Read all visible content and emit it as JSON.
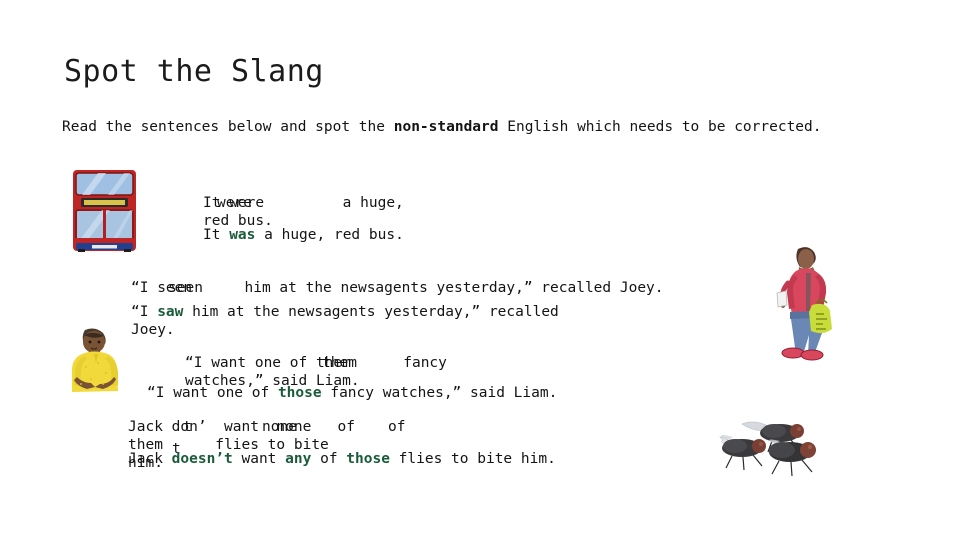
{
  "slide": {
    "title": "Spot the Slang",
    "intro_before": "Read the sentences below and spot the ",
    "intro_bold": "non-standard",
    "intro_after": " English which needs to be corrected.",
    "background_color": "#ffffff",
    "text_color": "#141414",
    "correction_color": "#1a5c3a"
  },
  "blocks": [
    {
      "id": "1",
      "original": "It were         a huge, red bus.",
      "original_fragments": [
        "were"
      ],
      "corrected_before": "It ",
      "corrected_fix": "was",
      "corrected_after": " a huge, red bus.",
      "image": "red-double-decker-bus"
    },
    {
      "id": "2",
      "original": "“I seen      him at the newsagents yesterday,” recalled Joey.",
      "original_fragments": [
        "seen"
      ],
      "corrected_before": "“I ",
      "corrected_fix": "saw",
      "corrected_after": " him at the newsagents yesterday,” recalled Joey.",
      "image": "woman-with-shopping-bag"
    },
    {
      "id": "3",
      "original": "“I want one of them      fancy watches,” said Liam.",
      "original_fragments": [
        "them"
      ],
      "corrected_before": "“I want one of ",
      "corrected_fix": "those",
      "corrected_after": " fancy watches,” said Liam.",
      "image": "boy-in-yellow-shirt"
    },
    {
      "id": "4",
      "original": "Jack don’  want  none   of   them      flies to bite  him.",
      "original_fragments": [
        "t",
        "none",
        "of",
        "t"
      ],
      "corrected_before": "Jack ",
      "corrected_fix": "doesn’t",
      "corrected_mid1": " want ",
      "corrected_fix2": "any",
      "corrected_mid2": " of ",
      "corrected_fix3": "those",
      "corrected_after": " flies to bite him.",
      "image": "three-house-flies"
    }
  ],
  "images": {
    "bus": {
      "name": "red-double-decker-bus",
      "body_color": "#cc2222",
      "window_color": "#a8c4e0",
      "sign_color": "#d8c24a"
    },
    "boy": {
      "name": "boy-in-yellow-shirt",
      "shirt_color": "#f2d93b",
      "skin_color": "#6b4a33"
    },
    "woman": {
      "name": "woman-with-shopping-bag",
      "jacket_color": "#d8475e",
      "jeans_color": "#6b87b5",
      "bag_color": "#c8dd3a"
    },
    "flies": {
      "name": "three-house-flies",
      "body_color": "#3a3a3c",
      "eye_color": "#7a3f34",
      "wing_color": "#cfd4da"
    }
  }
}
